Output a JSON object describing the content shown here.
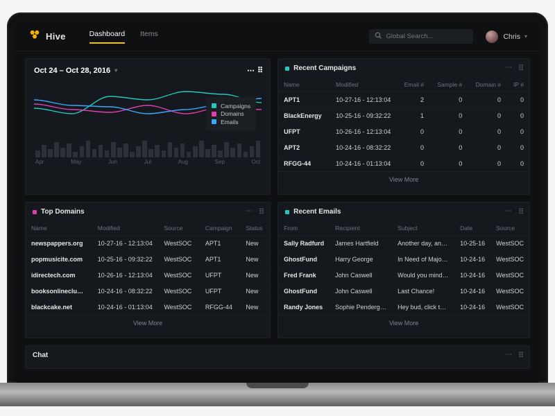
{
  "app": {
    "name": "Hive"
  },
  "nav": {
    "tabs": [
      {
        "label": "Dashboard",
        "active": true
      },
      {
        "label": "Items",
        "active": false
      }
    ]
  },
  "search": {
    "placeholder": "Global Search..."
  },
  "user": {
    "name": "Chris"
  },
  "datePanel": {
    "range": "Oct 24 – Oct 28, 2016",
    "legend": [
      {
        "label": "Campaigns",
        "color": "#22c9c1"
      },
      {
        "label": "Domains",
        "color": "#e03fb0"
      },
      {
        "label": "Emails",
        "color": "#3aa7ff"
      }
    ],
    "months": [
      "Apr",
      "May",
      "Jun",
      "Jul",
      "Aug",
      "Sep",
      "Oct"
    ]
  },
  "recentCampaigns": {
    "title": "Recent Campaigns",
    "headers": [
      "Name",
      "Modified",
      "Email #",
      "Sample #",
      "Domain #",
      "IP #"
    ],
    "rows": [
      {
        "name": "APT1",
        "modified": "10-27-16 - 12:13:04",
        "email": "2",
        "sample": "0",
        "domain": "0",
        "ip": "0"
      },
      {
        "name": "BlackEnergy",
        "modified": "10-25-16 - 09:32:22",
        "email": "1",
        "sample": "0",
        "domain": "0",
        "ip": "0"
      },
      {
        "name": "UFPT",
        "modified": "10-26-16 - 12:13:04",
        "email": "0",
        "sample": "0",
        "domain": "0",
        "ip": "0"
      },
      {
        "name": "APT2",
        "modified": "10-24-16 - 08:32:22",
        "email": "0",
        "sample": "0",
        "domain": "0",
        "ip": "0"
      },
      {
        "name": "RFGG-44",
        "modified": "10-24-16 - 01:13:04",
        "email": "0",
        "sample": "0",
        "domain": "0",
        "ip": "0"
      }
    ],
    "viewMore": "View More"
  },
  "topDomains": {
    "title": "Top Domains",
    "headers": [
      "Name",
      "Modified",
      "Source",
      "Campaign",
      "Status"
    ],
    "rows": [
      {
        "name": "newspappers.org",
        "modified": "10-27-16 - 12:13:04",
        "source": "WestSOC",
        "campaign": "APT1",
        "status": "New"
      },
      {
        "name": "popmusicite.com",
        "modified": "10-25-16 - 09:32:22",
        "source": "WestSOC",
        "campaign": "APT1",
        "status": "New"
      },
      {
        "name": "idirectech.com",
        "modified": "10-26-16 - 12:13:04",
        "source": "WestSOC",
        "campaign": "UFPT",
        "status": "New"
      },
      {
        "name": "booksonlineclub.com",
        "modified": "10-24-16 - 08:32:22",
        "source": "WestSOC",
        "campaign": "UFPT",
        "status": "New"
      },
      {
        "name": "blackcake.net",
        "modified": "10-24-16 - 01:13:04",
        "source": "WestSOC",
        "campaign": "RFGG-44",
        "status": "New"
      }
    ],
    "viewMore": "View More"
  },
  "recentEmails": {
    "title": "Recent Emails",
    "headers": [
      "From",
      "Recipient",
      "Subject",
      "Date",
      "Source"
    ],
    "rows": [
      {
        "from": "Sally Radfurd",
        "recipient": "James Hartfield",
        "subject": "Another day, another…",
        "date": "10-25-16",
        "source": "WestSOC"
      },
      {
        "from": "GhostFund",
        "recipient": "Harry George",
        "subject": "In Need of Major Help",
        "date": "10-24-16",
        "source": "WestSOC"
      },
      {
        "from": "Fred Frank",
        "recipient": "John Caswell",
        "subject": "Would you mind helpi…",
        "date": "10-24-16",
        "source": "WestSOC"
      },
      {
        "from": "GhostFund",
        "recipient": "John Caswell",
        "subject": "Last Chance!",
        "date": "10-24-16",
        "source": "WestSOC"
      },
      {
        "from": "Randy Jones",
        "recipient": "Sophie Pendergrass",
        "subject": "Hey bud, click this…",
        "date": "10-24-16",
        "source": "WestSOC"
      }
    ],
    "viewMore": "View More"
  },
  "chat": {
    "title": "Chat"
  },
  "chart_data": {
    "type": "line",
    "title": "",
    "x": [
      "Apr",
      "May",
      "Jun",
      "Jul",
      "Aug",
      "Sep",
      "Oct"
    ],
    "series": [
      {
        "name": "Campaigns",
        "color": "#22c9c1",
        "values": [
          38,
          30,
          55,
          50,
          62,
          58,
          46
        ]
      },
      {
        "name": "Domains",
        "color": "#e03fb0",
        "values": [
          44,
          36,
          32,
          42,
          30,
          40,
          36
        ]
      },
      {
        "name": "Emails",
        "color": "#3aa7ff",
        "values": [
          50,
          42,
          40,
          30,
          36,
          44,
          52
        ]
      }
    ],
    "ylim": [
      0,
      80
    ],
    "bar_ticks": [
      10,
      18,
      12,
      22,
      14,
      20,
      8,
      16,
      24,
      12,
      18,
      10,
      22,
      14,
      20,
      8,
      16,
      24,
      12,
      18,
      10,
      22,
      14,
      20,
      8,
      16,
      24,
      12,
      18,
      10,
      22,
      14,
      20,
      8,
      16,
      24
    ]
  }
}
